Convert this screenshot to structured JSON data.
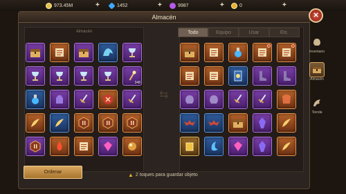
{
  "currency": [
    {
      "icon": "gold-coin-icon",
      "value": "973.45M",
      "color": "#e6c050"
    },
    {
      "icon": "blue-gem-icon",
      "value": "1452",
      "color": "#3ea8ff"
    },
    {
      "icon": "purple-gem-icon",
      "value": "9987",
      "color": "#b45ae8"
    },
    {
      "icon": "gold-token-icon",
      "value": "0",
      "color": "#e6b030"
    }
  ],
  "window": {
    "title": "Almacén",
    "left_panel_label": "Almacén"
  },
  "tabs": [
    {
      "label": "Todo",
      "active": true
    },
    {
      "label": "Equipo",
      "active": false
    },
    {
      "label": "Usar",
      "active": false
    },
    {
      "label": "Etc.",
      "active": false
    }
  ],
  "storage_items": [
    {
      "icon": "chest-icon",
      "quality": "purple"
    },
    {
      "icon": "scroll-icon",
      "quality": "orange"
    },
    {
      "icon": "chest-icon",
      "quality": "purple"
    },
    {
      "icon": "dragon-icon",
      "quality": "blue"
    },
    {
      "icon": "goblet-icon",
      "quality": "purple"
    },
    {
      "icon": "goblet-icon",
      "quality": "purple"
    },
    {
      "icon": "goblet-icon",
      "quality": "purple"
    },
    {
      "icon": "goblet-icon",
      "quality": "purple"
    },
    {
      "icon": "goblet-icon",
      "quality": "purple"
    },
    {
      "icon": "wand-icon",
      "quality": "purple",
      "count": "348"
    },
    {
      "icon": "potion-icon",
      "quality": "blue"
    },
    {
      "icon": "gauntlet-icon",
      "quality": "purple"
    },
    {
      "icon": "sword-icon",
      "quality": "purple"
    },
    {
      "icon": "rune-icon",
      "quality": "orange"
    },
    {
      "icon": "sword-icon",
      "quality": "purple"
    },
    {
      "icon": "feather-icon",
      "quality": "orange"
    },
    {
      "icon": "feather-icon",
      "quality": "blue"
    },
    {
      "icon": "sigil-icon",
      "quality": "orange"
    },
    {
      "icon": "sigil-icon",
      "quality": "orange"
    },
    {
      "icon": "sigil-icon",
      "quality": "orange"
    },
    {
      "icon": "sigil-icon",
      "quality": "purple"
    },
    {
      "icon": "fire-icon",
      "quality": "orange"
    },
    {
      "icon": "scroll-icon",
      "quality": "orange"
    },
    {
      "icon": "gem-icon",
      "quality": "purple"
    },
    {
      "icon": "orb-icon",
      "quality": "orange"
    }
  ],
  "inventory_items": [
    {
      "icon": "chest-icon",
      "quality": "orange"
    },
    {
      "icon": "scroll-icon",
      "quality": "orange"
    },
    {
      "icon": "potion-icon",
      "quality": "orange"
    },
    {
      "icon": "scroll-icon",
      "quality": "orange",
      "badge": true
    },
    {
      "icon": "scroll-icon",
      "quality": "orange",
      "badge": true
    },
    {
      "icon": "scroll-icon",
      "quality": "orange"
    },
    {
      "icon": "scroll-icon",
      "quality": "orange"
    },
    {
      "icon": "card-icon",
      "quality": "blue"
    },
    {
      "icon": "boots-icon",
      "quality": "purple"
    },
    {
      "icon": "boots-icon",
      "quality": "purple"
    },
    {
      "icon": "helmet-icon",
      "quality": "purple"
    },
    {
      "icon": "helmet-icon",
      "quality": "purple"
    },
    {
      "icon": "sword-icon",
      "quality": "purple"
    },
    {
      "icon": "sword-icon",
      "quality": "purple"
    },
    {
      "icon": "armor-icon",
      "quality": "orange"
    },
    {
      "icon": "bat-icon",
      "quality": "blue"
    },
    {
      "icon": "bat-icon",
      "quality": "blue"
    },
    {
      "icon": "chest-icon",
      "quality": "orange"
    },
    {
      "icon": "crystal-icon",
      "quality": "purple"
    },
    {
      "icon": "feather-icon",
      "quality": "orange"
    },
    {
      "icon": "gold-bar-icon",
      "quality": "gold"
    },
    {
      "icon": "moon-icon",
      "quality": "blue"
    },
    {
      "icon": "gem-icon",
      "quality": "purple"
    },
    {
      "icon": "crystal-icon",
      "quality": "purple"
    },
    {
      "icon": "feather-icon",
      "quality": "orange"
    }
  ],
  "buttons": {
    "order": "Ordenar"
  },
  "hint": "2 toques para guardar objeto",
  "nav": [
    {
      "label": "Inventario",
      "icon": "helmet-icon",
      "active": false
    },
    {
      "label": "Almacén",
      "icon": "chest-icon",
      "active": true
    },
    {
      "label": "Tienda",
      "icon": "wing-icon",
      "active": false
    }
  ]
}
